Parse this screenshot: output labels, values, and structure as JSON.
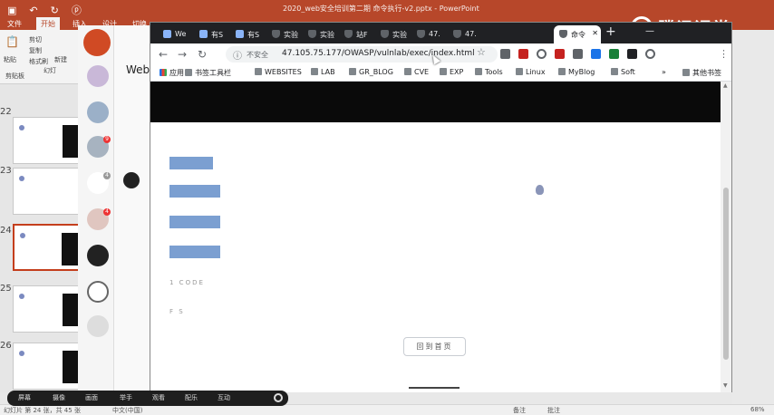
{
  "powerpoint": {
    "doc_title": "2020_web安全培训第二期 命令执行-v2.pptx - PowerPoint",
    "tabs": [
      "文件",
      "开始",
      "插入",
      "设计",
      "切换"
    ],
    "active_tab": "开始",
    "ribbon": {
      "paste": "粘贴",
      "cut": "剪切",
      "copy": "复制",
      "format": "格式刷",
      "clipboard": "剪贴板",
      "new": "新建",
      "layout": "幻灯"
    },
    "slide_numbers": [
      "22",
      "23",
      "24",
      "25",
      "26"
    ],
    "status": {
      "slide_info": "幻灯片 第 24 张，共 45 张",
      "language": "中文(中国)",
      "notes": "备注",
      "comments": "批注",
      "zoom": "68%"
    }
  },
  "watermark": {
    "text": "腾讯课堂"
  },
  "chat": {
    "panel_title": "Web",
    "badges": [
      "9",
      "4",
      "4"
    ]
  },
  "presenter": {
    "items": [
      "屏幕",
      "摄像",
      "画面",
      "举手",
      "观看",
      "配乐",
      "互动"
    ]
  },
  "browser": {
    "tabs": [
      {
        "label": "We",
        "icon": "page-icon"
      },
      {
        "label": "有S",
        "icon": "page-icon"
      },
      {
        "label": "有S",
        "icon": "page-icon"
      },
      {
        "label": "实验",
        "icon": "shield-icon"
      },
      {
        "label": "实验",
        "icon": "shield-icon"
      },
      {
        "label": "站F",
        "icon": "shield-icon"
      },
      {
        "label": "实验",
        "icon": "shield-icon"
      },
      {
        "label": "47.",
        "icon": "shield-icon"
      },
      {
        "label": "47.",
        "icon": "shield-icon"
      },
      {
        "label": "命令",
        "icon": "shield-icon",
        "active": true
      }
    ],
    "address": {
      "security": "不安全",
      "url": "47.105.75.177/OWASP/vulnlab/exec/index.html"
    },
    "bookmarks": [
      "应用",
      "书签工具栏",
      "WEBSITES",
      "LAB",
      "GR_BLOG",
      "CVE",
      "EXP",
      "Tools",
      "Linux",
      "MyBlog",
      "Soft",
      "»",
      "其他书签"
    ],
    "page": {
      "links": [
        "",
        "",
        "",
        ""
      ],
      "texts": [
        "1  CODE",
        "F  S"
      ],
      "home_button": "回到首页"
    }
  },
  "colors": {
    "ppt_red": "#b7472a",
    "chrome_dark": "#202124",
    "link_blue": "#7b9fd1",
    "header_black": "#0a0a0a"
  }
}
